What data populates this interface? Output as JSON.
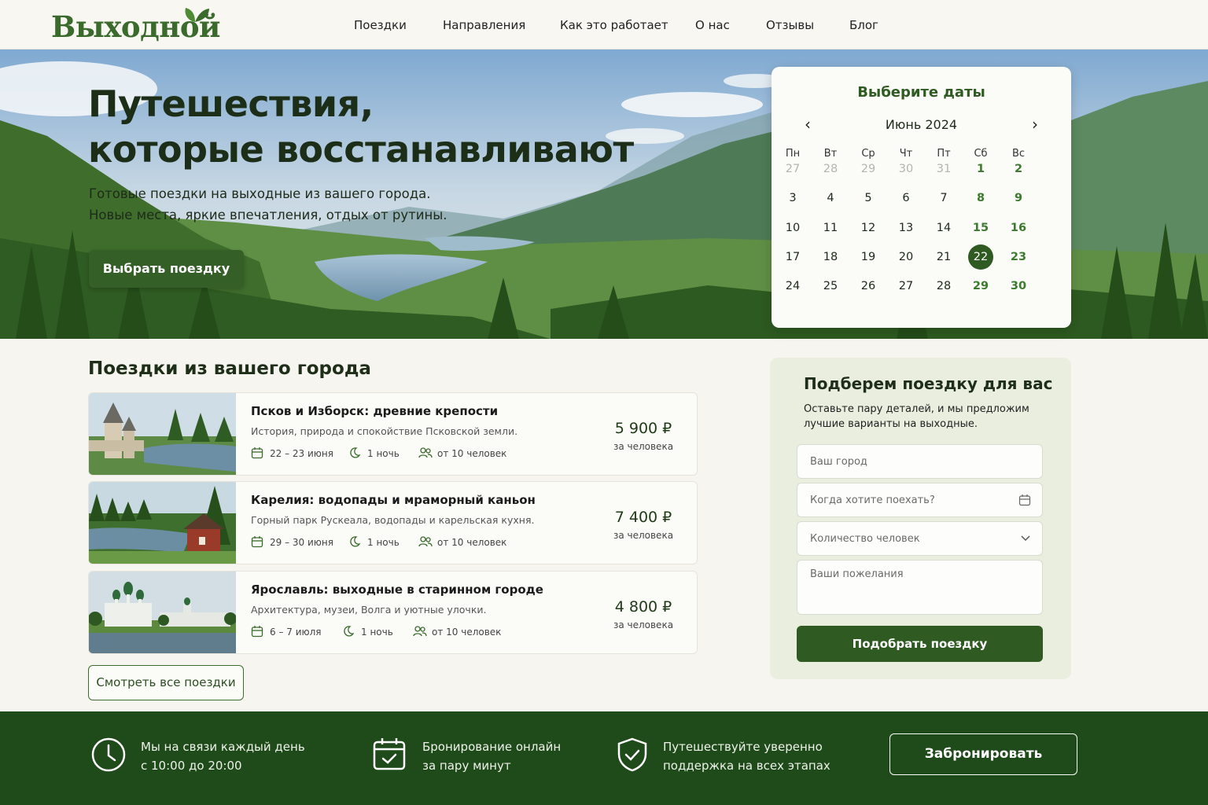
{
  "brand": {
    "logo": "Выходной",
    "accent": "#3b6b2c",
    "dark_green": "#2f5a22"
  },
  "nav": {
    "items": [
      "Поездки",
      "Направления",
      "Как это работает",
      "О нас",
      "Отзывы",
      "Блог"
    ]
  },
  "hero": {
    "title_line1": "Путешествия,",
    "title_line2": "которые восстанавливают",
    "subtitle_line1": "Готовые поездки на выходные из вашего города.",
    "subtitle_line2": "Новые места, яркие впечатления, отдых от рутины.",
    "cta": "Выбрать поездку"
  },
  "calendar": {
    "title": "Выберите даты",
    "month": "Июнь 2024",
    "prev_icon": "chevron-left-icon",
    "next_icon": "chevron-right-icon",
    "weekdays": [
      "Пн",
      "Вт",
      "Ср",
      "Чт",
      "Пт",
      "Сб",
      "Вс"
    ],
    "weeks": [
      [
        "27",
        "28",
        "29",
        "30",
        "31",
        "1",
        "2"
      ],
      [
        "3",
        "4",
        "5",
        "6",
        "7",
        "8",
        "9"
      ],
      [
        "10",
        "11",
        "12",
        "13",
        "14",
        "15",
        "16"
      ],
      [
        "17",
        "18",
        "19",
        "20",
        "21",
        "22",
        "23"
      ],
      [
        "24",
        "25",
        "26",
        "27",
        "28",
        "29",
        "30"
      ]
    ],
    "selected": "22"
  },
  "trips_section": {
    "title": "Поездки из вашего города",
    "trips": [
      {
        "title": "Псков и Изборск: древние крепости",
        "desc": "История, природа и спокойствие Псковской земли.",
        "dates": "22 – 23 июня",
        "nights": "1 ночь",
        "people": "от 10 человек",
        "price": "5 900 ₽",
        "per": "за человека"
      },
      {
        "title": "Карелия: водопады и мраморный каньон",
        "desc": "Горный парк Рускеала, водопады и карельская кухня.",
        "dates": "29 – 30 июня",
        "nights": "1 ночь",
        "people": "от 10 человек",
        "price": "7 400 ₽",
        "per": "за человека"
      },
      {
        "title": "Ярославль: выходные в старинном городе",
        "desc": "Архитектура, музеи, Волга и уютные улочки.",
        "dates": "6 – 7 июля",
        "nights": "1 ночь",
        "people": "от 10 человек",
        "price": "4 800 ₽",
        "per": "за человека"
      }
    ],
    "all_button": "Смотреть все поездки"
  },
  "form": {
    "title": "Подберем поездку для вас",
    "desc": "Оставьте пару деталей, и мы предложим лучшие варианты на выходные.",
    "city_placeholder": "Ваш город",
    "when_placeholder": "Когда хотите поехать?",
    "people_placeholder": "Количество человек",
    "wishes_placeholder": "Ваши пожелания",
    "submit": "Подобрать поездку"
  },
  "footer": {
    "features": [
      {
        "icon": "clock-icon",
        "line1": "Мы на связи каждый день",
        "line2": "с 10:00 до 20:00"
      },
      {
        "icon": "calendar-check-icon",
        "line1": "Бронирование онлайн",
        "line2": "за пару минут"
      },
      {
        "icon": "shield-check-icon",
        "line1": "Путешествуйте уверенно",
        "line2": "поддержка на всех этапах"
      }
    ],
    "book_button": "Забронировать"
  }
}
